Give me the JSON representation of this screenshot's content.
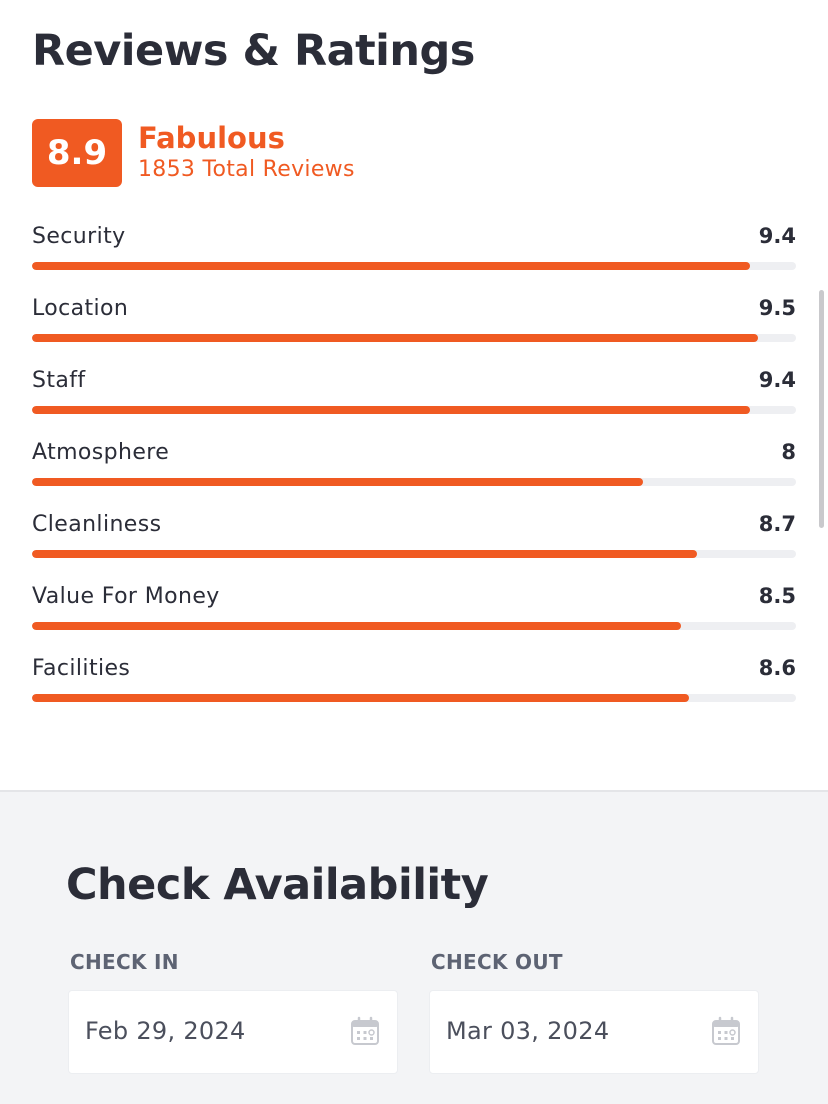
{
  "colors": {
    "accent": "#f05a22",
    "text": "#2b2d38",
    "track": "#eeeff2",
    "section_bg": "#f3f4f6"
  },
  "reviews": {
    "title": "Reviews & Ratings",
    "overall_score": "8.9",
    "overall_label": "Fabulous",
    "total_reviews": "1853 Total Reviews",
    "max_score": 10,
    "categories": [
      {
        "name": "Security",
        "value": "9.4",
        "score": 9.4
      },
      {
        "name": "Location",
        "value": "9.5",
        "score": 9.5
      },
      {
        "name": "Staff",
        "value": "9.4",
        "score": 9.4
      },
      {
        "name": "Atmosphere",
        "value": "8",
        "score": 8.0
      },
      {
        "name": "Cleanliness",
        "value": "8.7",
        "score": 8.7
      },
      {
        "name": "Value For Money",
        "value": "8.5",
        "score": 8.5
      },
      {
        "name": "Facilities",
        "value": "8.6",
        "score": 8.6
      }
    ]
  },
  "availability": {
    "title": "Check Availability",
    "check_in": {
      "label": "CHECK IN",
      "value": "Feb 29, 2024",
      "icon": "calendar-icon"
    },
    "check_out": {
      "label": "CHECK OUT",
      "value": "Mar 03, 2024",
      "icon": "calendar-icon"
    }
  }
}
